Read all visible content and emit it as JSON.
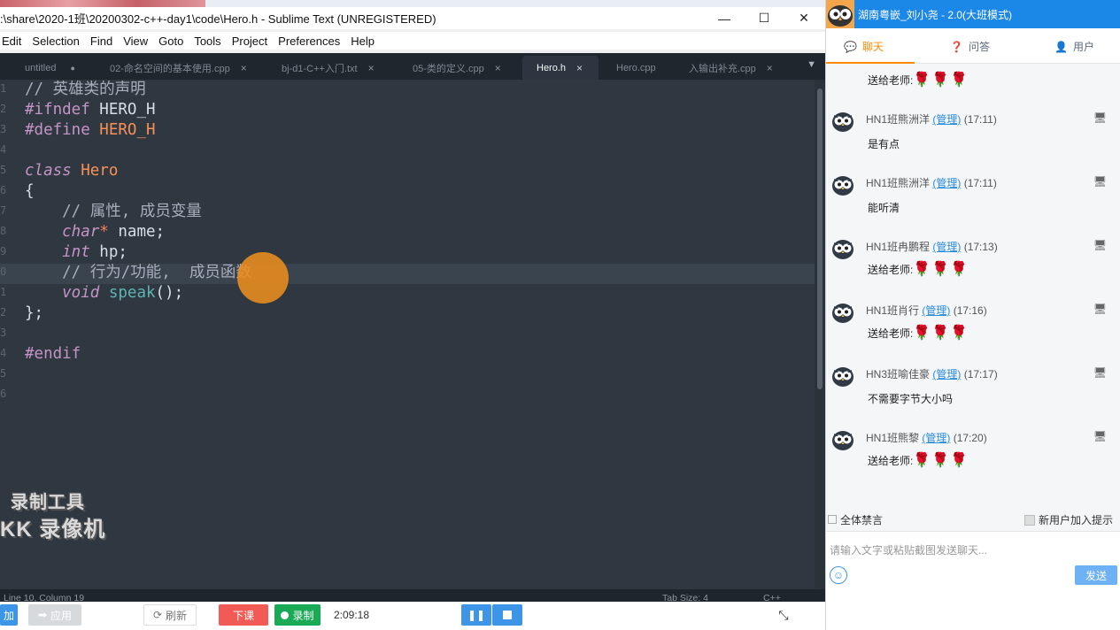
{
  "sublime": {
    "title": ":\\share\\2020-1班\\20200302-c++-day1\\code\\Hero.h - Sublime Text (UNREGISTERED)",
    "menu": [
      "Edit",
      "Selection",
      "Find",
      "View",
      "Goto",
      "Tools",
      "Project",
      "Preferences",
      "Help"
    ],
    "tabs": [
      {
        "label": "untitled",
        "close": "●"
      },
      {
        "label": "02-命名空间的基本使用.cpp",
        "close": "×"
      },
      {
        "label": "bj-d1-C++入门.txt",
        "close": "×"
      },
      {
        "label": "05-类的定义.cpp",
        "close": "×"
      },
      {
        "label": "Hero.h",
        "close": "×"
      },
      {
        "label": "Hero.cpp",
        "close": ""
      },
      {
        "label": "入输出补充.cpp",
        "close": "×"
      }
    ],
    "tab_menu_icon": "triangle-down-icon",
    "code": {
      "l1": "// 英雄类的声明",
      "l2a": "#ifndef",
      "l2b": " HERO_H",
      "l3a": "#define",
      "l3b": " HERO_H",
      "l5a": "class",
      "l5b": " Hero",
      "l6": "{",
      "l7": "    // 属性, 成员变量",
      "l8a": "    char",
      "l8b": "*",
      "l8c": " name;",
      "l9a": "    int",
      "l9b": " hp;",
      "l10": "    // 行为/功能,  成员函数",
      "l11a": "    void",
      "l11b": " speak",
      "l11c": "();",
      "l12": "};",
      "l14": "#endif"
    },
    "gutter": [
      "1",
      "2",
      "3",
      "4",
      "5",
      "6",
      "7",
      "8",
      "9",
      "0",
      "1",
      "2",
      "3",
      "4",
      "5",
      "6"
    ],
    "status": {
      "pos": "Line 10, Column 19",
      "tab_size": "Tab Size: 4",
      "syntax": "C++"
    },
    "watermark": {
      "line1": "录制工具",
      "line2": "KK 录像机"
    }
  },
  "toolbar": {
    "add": "加",
    "apply": "应用",
    "refresh": "刷新",
    "end_class": "下课",
    "record": "录制",
    "timer": "2:09:18"
  },
  "chat": {
    "header_title": "湖南粤嵌_刘小尧 - 2.0(大班模式)",
    "tabs": [
      {
        "label": "聊天",
        "icon": "chat-bubble-icon"
      },
      {
        "label": "问答",
        "icon": "question-icon"
      },
      {
        "label": "用户",
        "icon": "user-icon"
      }
    ],
    "top_gift": "送给老师:",
    "messages": [
      {
        "user": "HN1班熊洲洋",
        "tag": "(管理)",
        "time": "(17:11)",
        "text": "是有点",
        "gift": false
      },
      {
        "user": "HN1班熊洲洋",
        "tag": "(管理)",
        "time": "(17:11)",
        "text": "能听清",
        "gift": false
      },
      {
        "user": "HN1班冉鹏程",
        "tag": "(管理)",
        "time": "(17:13)",
        "text": "送给老师:",
        "gift": true
      },
      {
        "user": "HN1班肖行",
        "tag": "(管理)",
        "time": "(17:16)",
        "text": "送给老师:",
        "gift": true
      },
      {
        "user": "HN3班喻佳豪",
        "tag": "(管理)",
        "time": "(17:17)",
        "text": "不需要字节大小吗",
        "gift": false
      },
      {
        "user": "HN1班熊黎",
        "tag": "(管理)",
        "time": "(17:20)",
        "text": "送给老师:",
        "gift": true
      }
    ],
    "roses": "🌹🌹🌹",
    "mute_all": "全体禁言",
    "new_user_tip": "新用户加入提示",
    "input_placeholder": "请输入文字或粘贴截图发送聊天...",
    "send": "发送"
  }
}
